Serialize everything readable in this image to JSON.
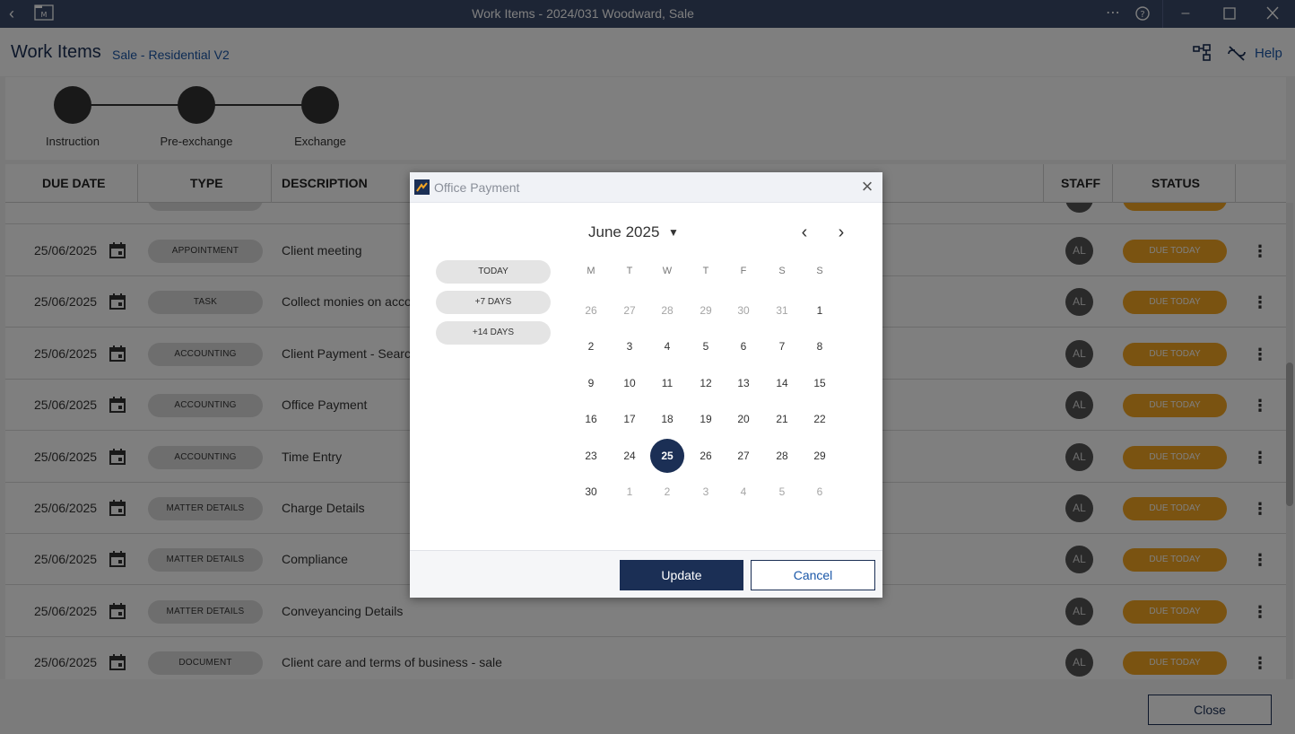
{
  "window": {
    "title": "Work Items - 2024/031 Woodward, Sale",
    "back_icon": "chevron-left-icon",
    "app_icon": "matter-folder-icon",
    "controls": [
      "more-icon",
      "help-circle-icon",
      "minimize-icon",
      "maximize-icon",
      "close-icon"
    ]
  },
  "header": {
    "title": "Work Items",
    "subtitle": "Sale - Residential V2",
    "help_label": "Help",
    "icons": [
      "workflow-icon",
      "unlink-icon"
    ]
  },
  "stepper": {
    "steps": [
      {
        "label": "Instruction"
      },
      {
        "label": "Pre-exchange"
      },
      {
        "label": "Exchange"
      }
    ]
  },
  "table": {
    "columns": {
      "due_date": "DUE DATE",
      "type": "TYPE",
      "description": "DESCRIPTION",
      "staff": "STAFF",
      "status": "STATUS"
    },
    "rows": [
      {
        "date": "25/06/2025",
        "type": "APPOINTMENT",
        "description": "Client meeting",
        "staff": "AL",
        "status": "DUE TODAY"
      },
      {
        "date": "25/06/2025",
        "type": "TASK",
        "description": "Collect monies on account",
        "staff": "AL",
        "status": "DUE TODAY"
      },
      {
        "date": "25/06/2025",
        "type": "ACCOUNTING",
        "description": "Client Payment - Searches",
        "staff": "AL",
        "status": "DUE TODAY"
      },
      {
        "date": "25/06/2025",
        "type": "ACCOUNTING",
        "description": "Office Payment",
        "staff": "AL",
        "status": "DUE TODAY"
      },
      {
        "date": "25/06/2025",
        "type": "ACCOUNTING",
        "description": "Time Entry",
        "staff": "AL",
        "status": "DUE TODAY"
      },
      {
        "date": "25/06/2025",
        "type": "MATTER DETAILS",
        "description": "Charge Details",
        "staff": "AL",
        "status": "DUE TODAY"
      },
      {
        "date": "25/06/2025",
        "type": "MATTER DETAILS",
        "description": "Compliance",
        "staff": "AL",
        "status": "DUE TODAY"
      },
      {
        "date": "25/06/2025",
        "type": "MATTER DETAILS",
        "description": "Conveyancing Details",
        "staff": "AL",
        "status": "DUE TODAY"
      },
      {
        "date": "25/06/2025",
        "type": "DOCUMENT",
        "description": "Client care and terms of business - sale",
        "staff": "AL",
        "status": "DUE TODAY"
      }
    ]
  },
  "footer": {
    "close_label": "Close"
  },
  "dialog": {
    "title": "Office Payment",
    "quick_picks": [
      "TODAY",
      "+7 DAYS",
      "+14 DAYS"
    ],
    "month_label": "June 2025",
    "weekdays": [
      "M",
      "T",
      "W",
      "T",
      "F",
      "S",
      "S"
    ],
    "weeks": [
      [
        "26",
        "27",
        "28",
        "29",
        "30",
        "31",
        "1"
      ],
      [
        "2",
        "3",
        "4",
        "5",
        "6",
        "7",
        "8"
      ],
      [
        "9",
        "10",
        "11",
        "12",
        "13",
        "14",
        "15"
      ],
      [
        "16",
        "17",
        "18",
        "19",
        "20",
        "21",
        "22"
      ],
      [
        "23",
        "24",
        "25",
        "26",
        "27",
        "28",
        "29"
      ],
      [
        "30",
        "1",
        "2",
        "3",
        "4",
        "5",
        "6"
      ]
    ],
    "selected_day": "25",
    "update_label": "Update",
    "cancel_label": "Cancel"
  },
  "colors": {
    "navy": "#1b2f55",
    "status_due_today": "#f5a623",
    "link_blue": "#1a57a8"
  }
}
